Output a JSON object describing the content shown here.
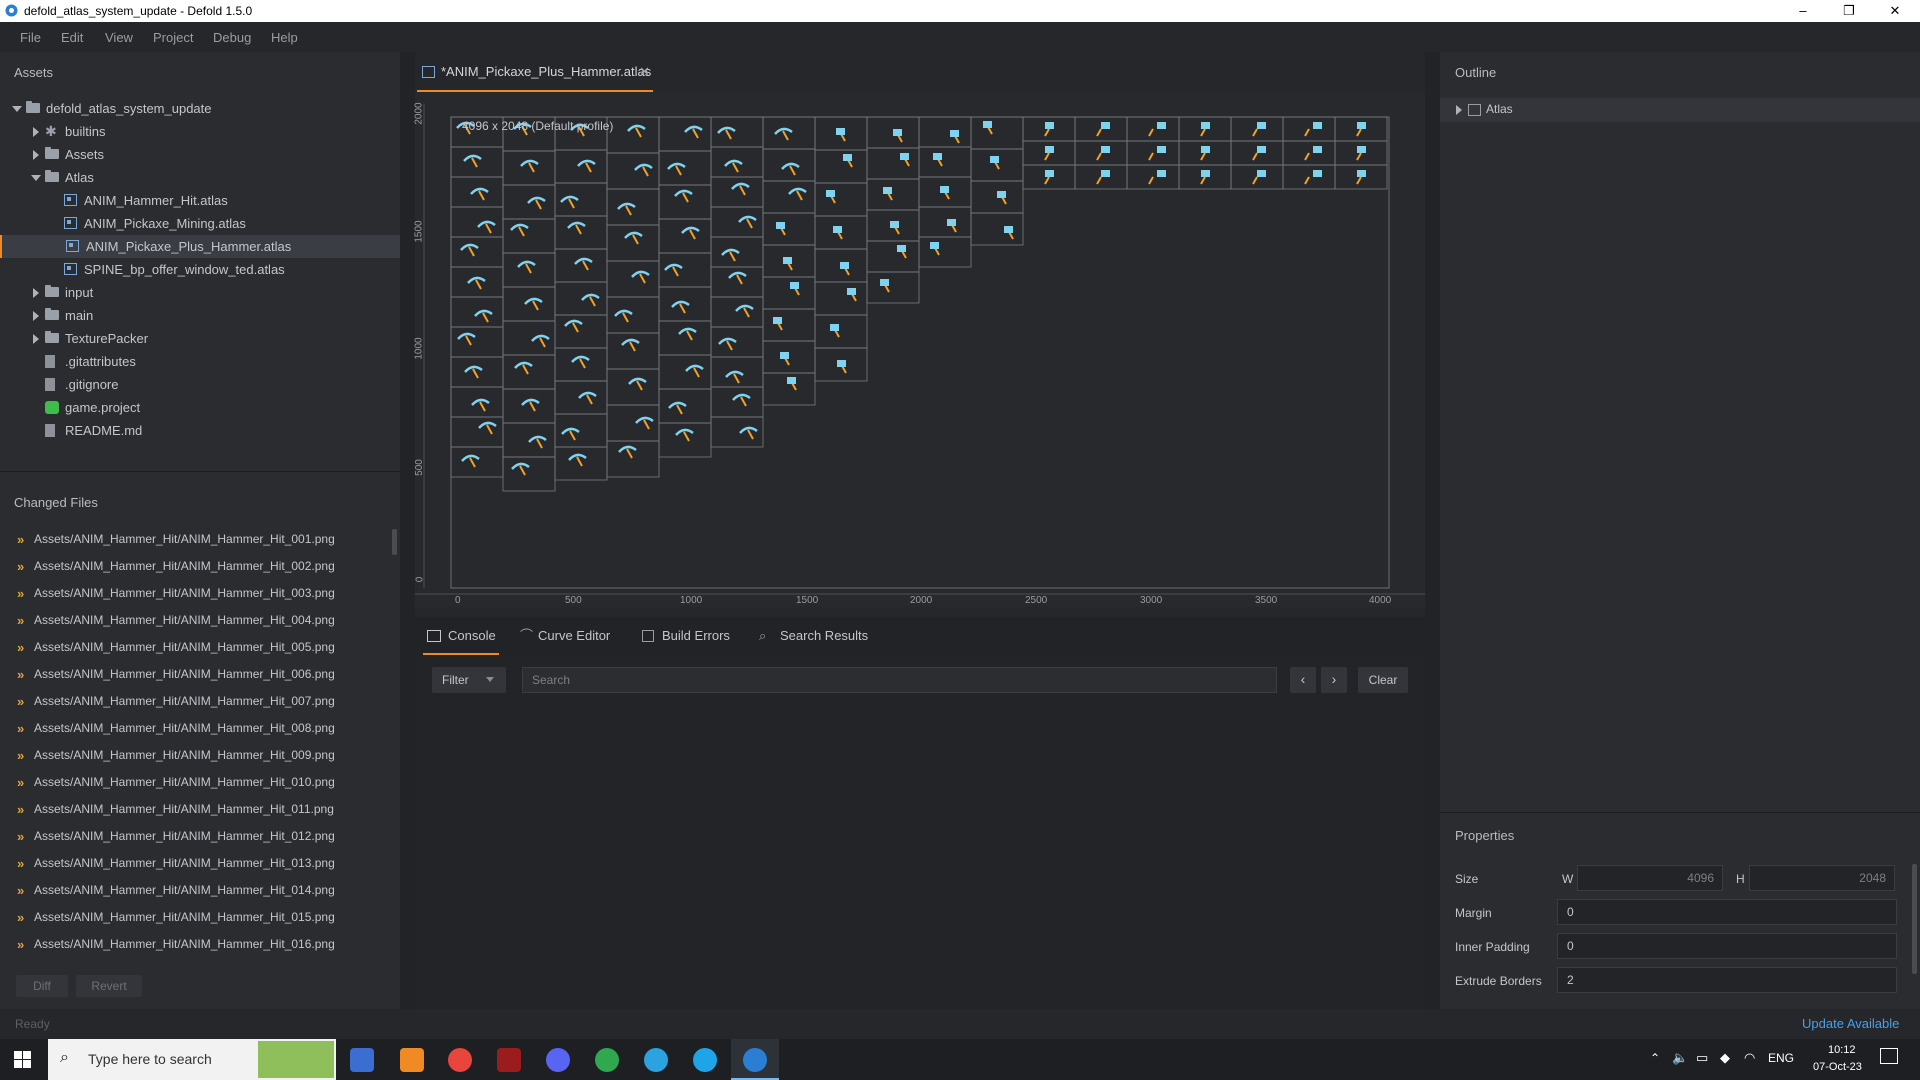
{
  "window": {
    "title": "defold_atlas_system_update - Defold 1.5.0",
    "controls": [
      "–",
      "❐",
      "✕"
    ]
  },
  "menu": [
    "File",
    "Edit",
    "View",
    "Project",
    "Debug",
    "Help"
  ],
  "assets": {
    "title": "Assets",
    "tree": [
      {
        "label": "defold_atlas_system_update",
        "type": "folder",
        "expanded": true,
        "depth": 0
      },
      {
        "label": "builtins",
        "type": "builtin",
        "expanded": false,
        "depth": 1
      },
      {
        "label": "Assets",
        "type": "folder",
        "expanded": false,
        "depth": 1
      },
      {
        "label": "Atlas",
        "type": "folder",
        "expanded": true,
        "depth": 1
      },
      {
        "label": "ANIM_Hammer_Hit.atlas",
        "type": "atlas",
        "depth": 2
      },
      {
        "label": "ANIM_Pickaxe_Mining.atlas",
        "type": "atlas",
        "depth": 2
      },
      {
        "label": "ANIM_Pickaxe_Plus_Hammer.atlas",
        "type": "atlas",
        "depth": 2,
        "selected": true
      },
      {
        "label": "SPINE_bp_offer_window_ted.atlas",
        "type": "atlas",
        "depth": 2
      },
      {
        "label": "input",
        "type": "folder",
        "expanded": false,
        "depth": 1
      },
      {
        "label": "main",
        "type": "folder",
        "expanded": false,
        "depth": 1
      },
      {
        "label": "TexturePacker",
        "type": "folder",
        "expanded": false,
        "depth": 1
      },
      {
        "label": ".gitattributes",
        "type": "file",
        "depth": 1
      },
      {
        "label": ".gitignore",
        "type": "file",
        "depth": 1
      },
      {
        "label": "game.project",
        "type": "project",
        "depth": 1
      },
      {
        "label": "README.md",
        "type": "file",
        "depth": 1
      }
    ]
  },
  "changed_files": {
    "title": "Changed Files",
    "files": [
      "Assets/ANIM_Hammer_Hit/ANIM_Hammer_Hit_001.png",
      "Assets/ANIM_Hammer_Hit/ANIM_Hammer_Hit_002.png",
      "Assets/ANIM_Hammer_Hit/ANIM_Hammer_Hit_003.png",
      "Assets/ANIM_Hammer_Hit/ANIM_Hammer_Hit_004.png",
      "Assets/ANIM_Hammer_Hit/ANIM_Hammer_Hit_005.png",
      "Assets/ANIM_Hammer_Hit/ANIM_Hammer_Hit_006.png",
      "Assets/ANIM_Hammer_Hit/ANIM_Hammer_Hit_007.png",
      "Assets/ANIM_Hammer_Hit/ANIM_Hammer_Hit_008.png",
      "Assets/ANIM_Hammer_Hit/ANIM_Hammer_Hit_009.png",
      "Assets/ANIM_Hammer_Hit/ANIM_Hammer_Hit_010.png",
      "Assets/ANIM_Hammer_Hit/ANIM_Hammer_Hit_011.png",
      "Assets/ANIM_Hammer_Hit/ANIM_Hammer_Hit_012.png",
      "Assets/ANIM_Hammer_Hit/ANIM_Hammer_Hit_013.png",
      "Assets/ANIM_Hammer_Hit/ANIM_Hammer_Hit_014.png",
      "Assets/ANIM_Hammer_Hit/ANIM_Hammer_Hit_015.png",
      "Assets/ANIM_Hammer_Hit/ANIM_Hammer_Hit_016.png"
    ],
    "diff_label": "Diff",
    "revert_label": "Revert"
  },
  "editor": {
    "tab_label": "*ANIM_Pickaxe_Plus_Hammer.atlas",
    "canvas_label": "4096 x 2048 (Default profile)",
    "ruler_x": [
      "0",
      "500",
      "1000",
      "1500",
      "2000",
      "2500",
      "3000",
      "3500",
      "4000"
    ],
    "ruler_y": [
      "2000",
      "1500",
      "1000",
      "500",
      "0"
    ]
  },
  "bottom_tabs": [
    "Console",
    "Curve Editor",
    "Build Errors",
    "Search Results"
  ],
  "console": {
    "filter_label": "Filter",
    "search_placeholder": "Search",
    "clear_label": "Clear"
  },
  "outline": {
    "title": "Outline",
    "root": "Atlas"
  },
  "properties": {
    "title": "Properties",
    "size_label": "Size",
    "w_label": "W",
    "w_value": "4096",
    "h_label": "H",
    "h_value": "2048",
    "margin_label": "Margin",
    "margin_value": "0",
    "inner_padding_label": "Inner Padding",
    "inner_padding_value": "0",
    "extrude_label": "Extrude Borders",
    "extrude_value": "2"
  },
  "status": {
    "left": "Ready",
    "right": "Update Available"
  },
  "taskbar": {
    "search_placeholder": "Type here to search",
    "lang": "ENG",
    "time": "10:12",
    "date": "07-Oct-23"
  },
  "colors": {
    "accent": "#f08a24",
    "update": "#4a9fe8",
    "hammer": "#7fd3f0",
    "pick": "#f0a12a"
  }
}
